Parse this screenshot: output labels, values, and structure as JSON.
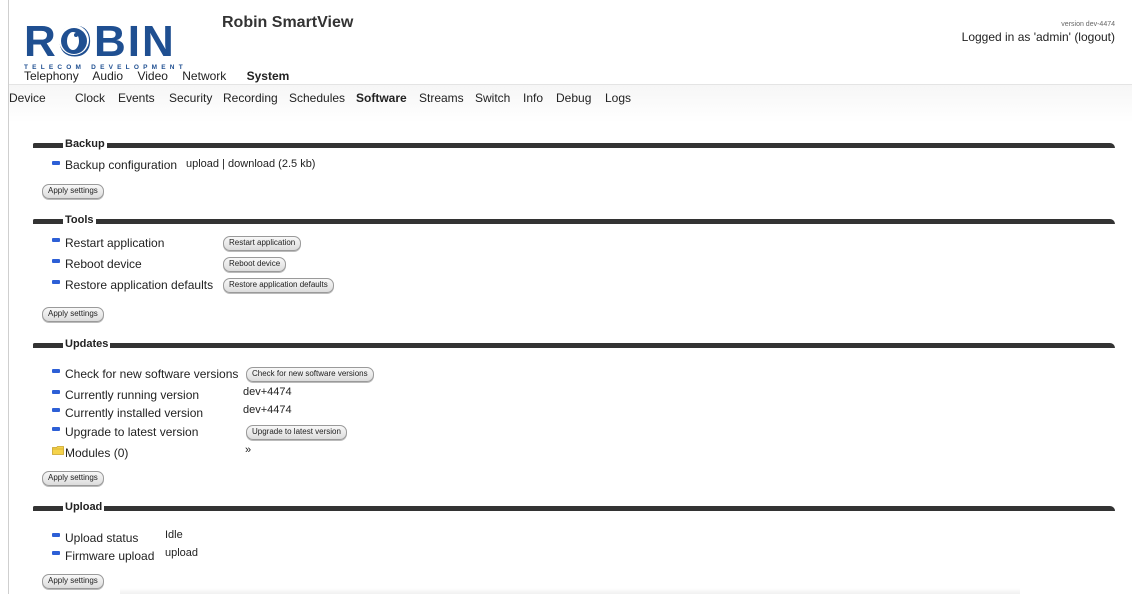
{
  "header": {
    "logo_text": "ROBIN",
    "logo_subtext": "TELECOM DEVELOPMENT",
    "app_title": "Robin SmartView",
    "version": "version dev-4474",
    "login_prefix": "Logged in as 'admin'",
    "logout": "(logout)"
  },
  "mainnav": [
    "Telephony",
    "Audio",
    "Video",
    "Network",
    "System"
  ],
  "mainnav_active": "System",
  "subnav": [
    "Device",
    "Clock",
    "Events",
    "Security",
    "Recording",
    "Schedules",
    "Software",
    "Streams",
    "Switch",
    "Info",
    "Debug",
    "Logs"
  ],
  "subnav_active": "Software",
  "colors": {
    "bullet": "#2d5fd6",
    "section_bar": "#333333"
  },
  "backup": {
    "title": "Backup",
    "config_label": "Backup configuration",
    "upload": "upload",
    "sep": "|",
    "download": "download (2.5 kb)",
    "apply": "Apply settings"
  },
  "tools": {
    "title": "Tools",
    "restart_label": "Restart application",
    "restart_btn": "Restart application",
    "reboot_label": "Reboot device",
    "reboot_btn": "Reboot device",
    "restore_label": "Restore application defaults",
    "restore_btn": "Restore application defaults",
    "apply": "Apply settings"
  },
  "updates": {
    "title": "Updates",
    "check_label": "Check for new software versions",
    "check_btn": "Check for new software versions",
    "running_label": "Currently running version",
    "running_value": "dev+4474",
    "installed_label": "Currently installed version",
    "installed_value": "dev+4474",
    "upgrade_label": "Upgrade to latest version",
    "upgrade_btn": "Upgrade to latest version",
    "modules_label": "Modules (0)",
    "modules_link": "»",
    "apply": "Apply settings"
  },
  "upload": {
    "title": "Upload",
    "status_label": "Upload status",
    "status_value": "Idle",
    "firmware_label": "Firmware upload",
    "firmware_link": "upload",
    "apply": "Apply settings"
  }
}
